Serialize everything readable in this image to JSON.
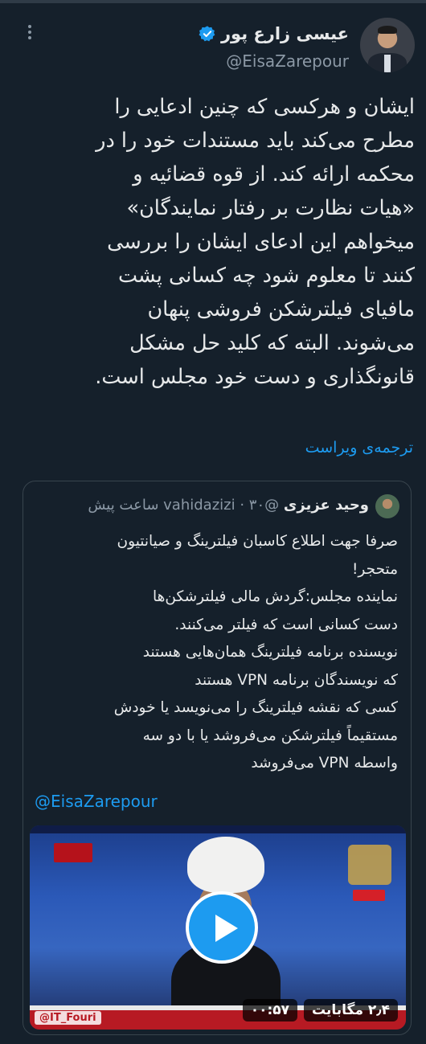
{
  "author": {
    "display_name": "عیسی زارع پور",
    "handle": "@EisaZarepour",
    "verified": true,
    "accent_color": "#1d9bf0"
  },
  "tweet": {
    "text": "ایشان و هرکسی که چنین ادعایی را\nمطرح می‌کند باید مستندات خود را در\nمحکمه ارائه کند. از قوه قضائیه و\n«هیات نظارت بر رفتار نمایندگان»\nمیخواهم این ادعای ایشان را بررسی\nکنند تا معلوم شود چه کسانی پشت\nمافیای فیلترشکن فروشی پنهان\nمی‌شوند. البته که کلید حل مشکل\nقانونگذاری و دست خود مجلس است.",
    "translate_label": "ترجمه‌ی ویراست"
  },
  "quoted_tweet": {
    "display_name": "وحید عزیزی",
    "handle": "@vahidazizi",
    "separator": "·",
    "time": "۳۰ ساعت پیش",
    "text": "صرفا جهت اطلاع کاسبان فیلترینگ و صیانتیون\nمتحجر!\n نماینده مجلس:گردش مالی فیلترشکن‌ها\nدست کسانی است که فیلتر می‌کنند.\nنویسنده برنامه فیلترینگ همان‌هایی هستند\nکه نویسندگان برنامه VPN هستند\nکسی که نقشه فیلترینگ را می‌نویسد یا خودش\nمستقیماً فیلترشکن می‌فروشد یا با دو سه\nواسطه VPN می‌فروشد",
    "mention": "@EisaZarepour",
    "video": {
      "duration": "۰۰:۵۷",
      "size": "۲٫۴ مگابایت",
      "source_tag": "@IT_Fouri"
    }
  },
  "colors": {
    "background": "#15202b",
    "text": "#e7e9ea",
    "muted": "#8b98a5",
    "border": "#38444d",
    "link": "#1d9bf0"
  },
  "icons": {
    "more": "more-vertical-icon",
    "verified": "verified-badge-icon",
    "play": "play-icon"
  }
}
